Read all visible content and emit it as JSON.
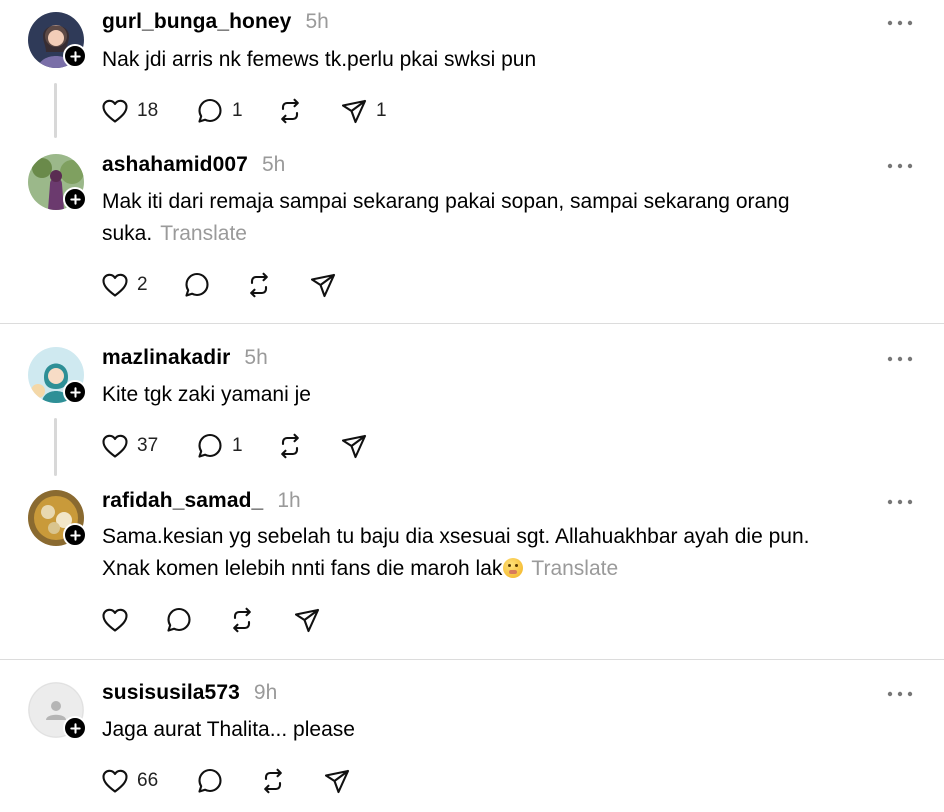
{
  "posts": [
    {
      "username": "gurl_bunga_honey",
      "time": "5h",
      "text": "Nak jdi arris nk femews tk.perlu pkai swksi pun",
      "translate": "",
      "likes": "18",
      "replies": "1",
      "reposts": "",
      "shares": "1",
      "avatar_color": "#2f3a58"
    },
    {
      "username": "ashahamid007",
      "time": "5h",
      "text_line1": "Mak iti dari remaja sampai sekarang pakai sopan, sampai sekarang orang",
      "text_line2": "suka.",
      "translate": "Translate",
      "likes": "2",
      "replies": "",
      "reposts": "",
      "shares": "",
      "avatar_color": "#6a8a4a"
    },
    {
      "username": "mazlinakadir",
      "time": "5h",
      "text": "Kite tgk zaki yamani je",
      "likes": "37",
      "replies": "1",
      "reposts": "",
      "shares": "",
      "avatar_color": "#a9d8e6"
    },
    {
      "username": "rafidah_samad_",
      "time": "1h",
      "text_line1": "Sama.kesian yg sebelah tu baju dia xsesuai sgt. Allahuakhbar ayah die pun.",
      "text_line2": "Xnak komen lelebih nnti fans die maroh lak",
      "translate": "Translate",
      "likes": "",
      "replies": "",
      "reposts": "",
      "shares": "",
      "avatar_color": "#b8862c"
    },
    {
      "username": "susisusila573",
      "time": "9h",
      "text": "Jaga aurat Thalita... please",
      "likes": "66",
      "replies": "",
      "reposts": "",
      "shares": "",
      "avatar_color": "#e8e8e8"
    }
  ]
}
